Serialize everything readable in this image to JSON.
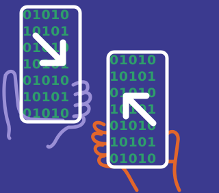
{
  "illustration": {
    "background_color": "#3b3a8f",
    "screen_color": "#3b3a8f",
    "binary_color": "#2e9e6b",
    "outline_color": "#ffffff",
    "left_hand_color": "#9a8fd6",
    "right_hand_color": "#e2662b",
    "left_phone": {
      "arrow": "down-right-arrow-icon",
      "binary_rows": [
        "01010",
        "10101",
        "01010",
        "10101",
        "01010",
        "10101",
        "01010"
      ]
    },
    "right_phone": {
      "arrow": "up-left-arrow-icon",
      "binary_rows": [
        "01010",
        "10101",
        "01010",
        "10101",
        "01010",
        "10101",
        "01010"
      ]
    }
  }
}
